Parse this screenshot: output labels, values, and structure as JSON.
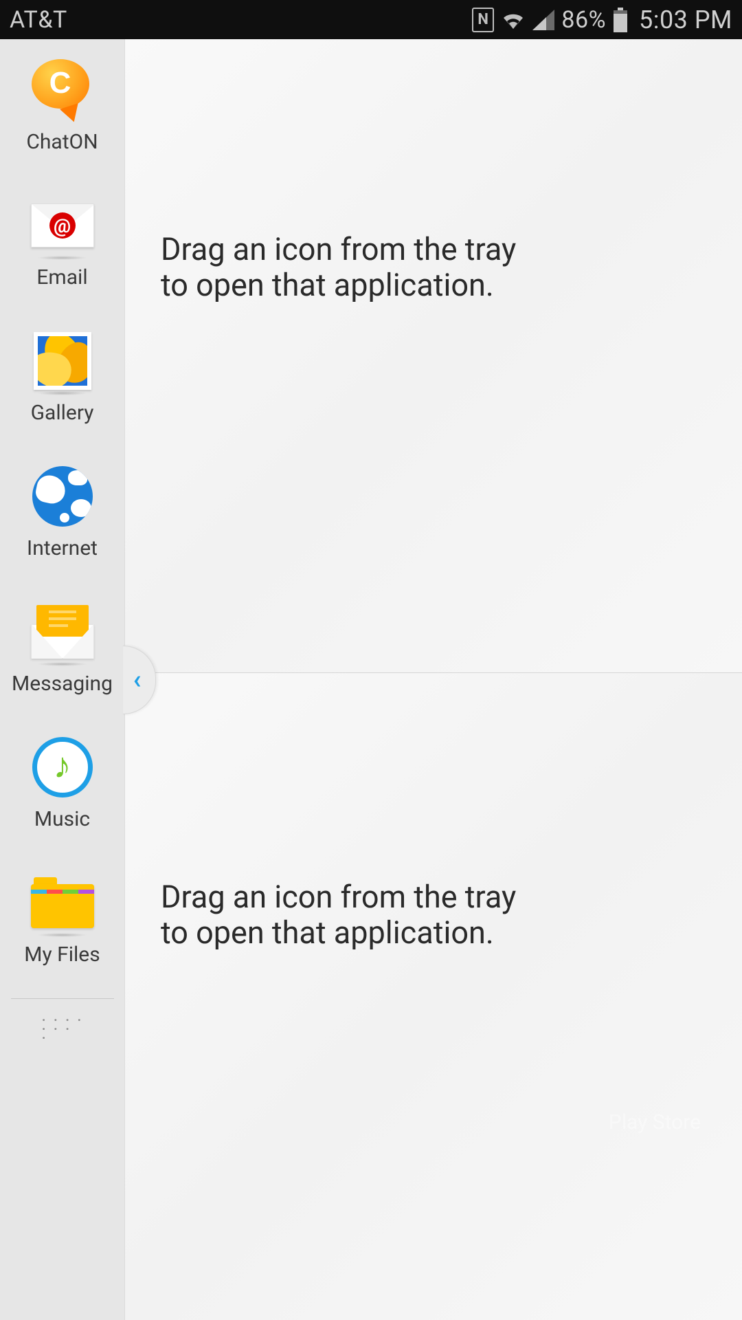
{
  "status": {
    "carrier": "AT&T",
    "battery_pct": "86%",
    "time": "5:03 PM"
  },
  "tray": {
    "items": [
      {
        "label": "ChatON"
      },
      {
        "label": "Email"
      },
      {
        "label": "Gallery"
      },
      {
        "label": "Internet"
      },
      {
        "label": "Messaging"
      },
      {
        "label": "Music"
      },
      {
        "label": "My Files"
      }
    ]
  },
  "zones": {
    "top_hint": "Drag an icon from the tray to open that application.",
    "bottom_hint": "Drag an icon from the tray to open that application.",
    "ghost_app": "Play Store"
  }
}
